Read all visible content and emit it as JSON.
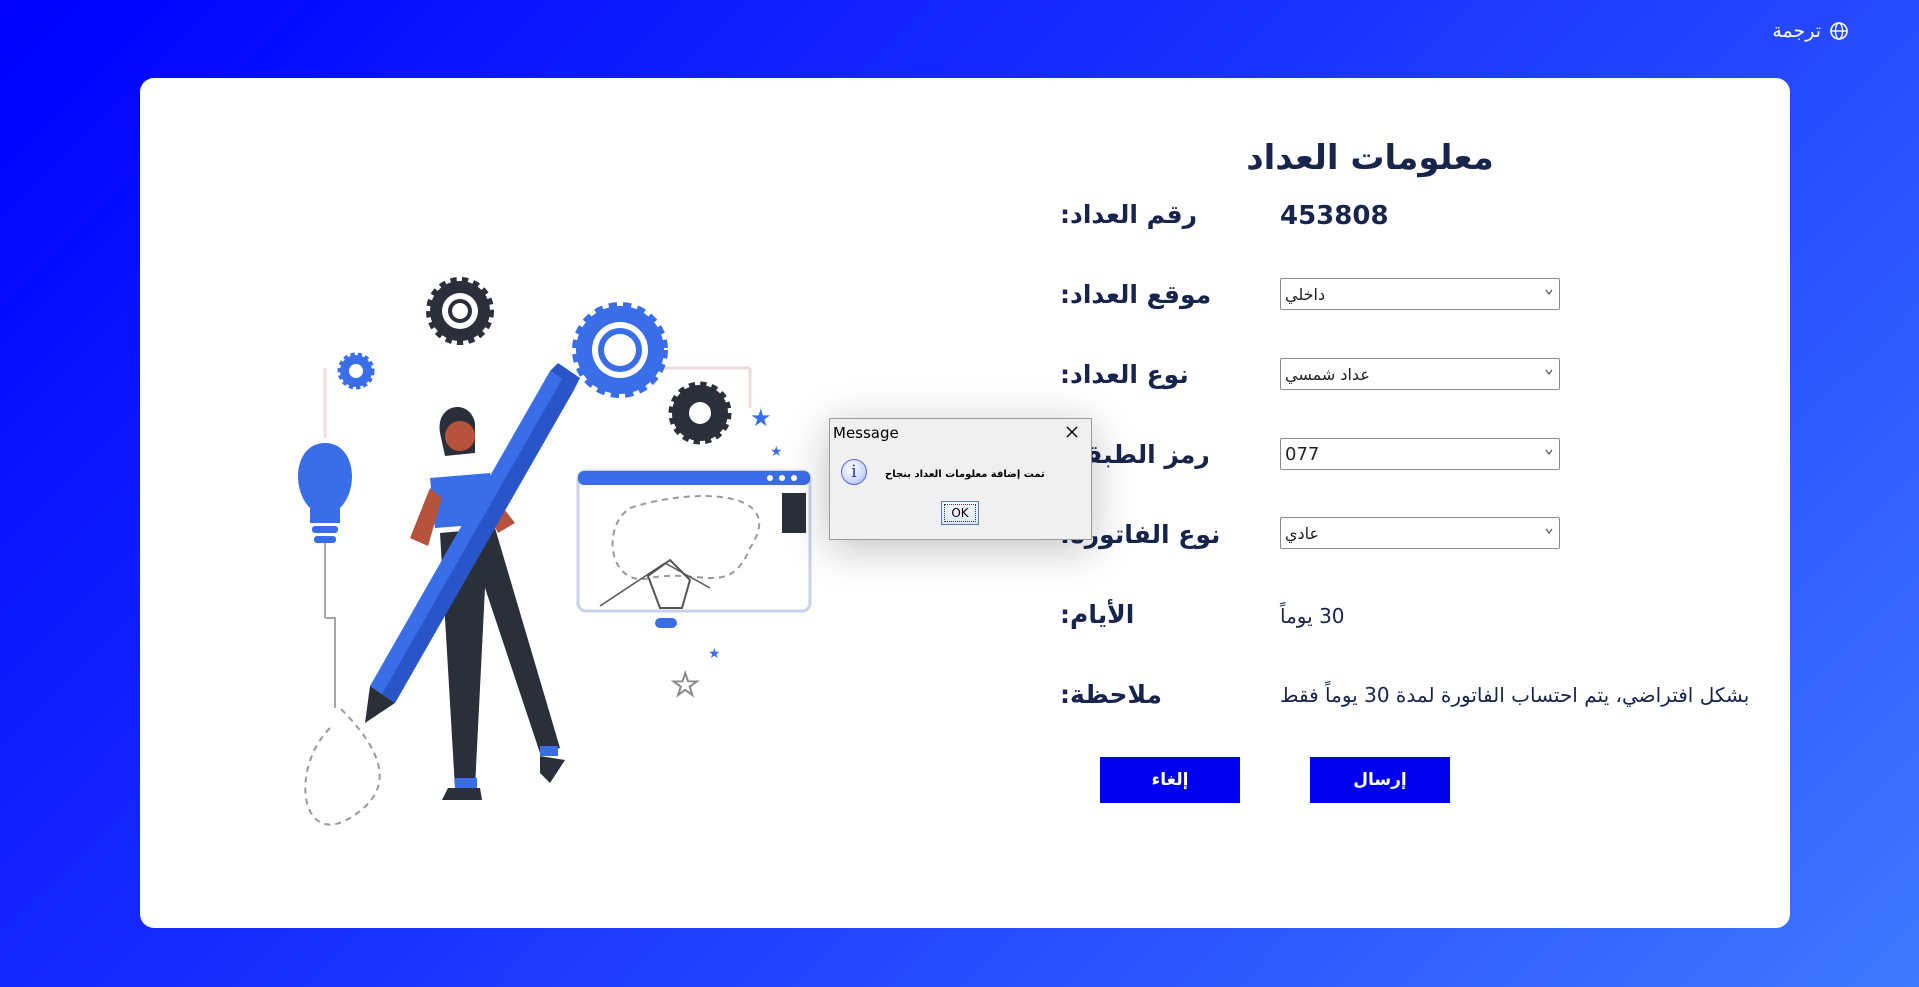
{
  "header": {
    "translate_label": "ترجمة",
    "translate_icon": "globe-icon"
  },
  "form": {
    "title": "معلومات العداد",
    "meter_number_label": "رقم العداد:",
    "meter_number_value": "453808",
    "location_label": "موقع العداد:",
    "location_value": "داخلي",
    "type_label": "نوع العداد:",
    "type_value": "عداد شمسي",
    "code_label": "رمز الطبقة:",
    "code_value": "077",
    "invoice_type_label": "نوع الفاتورة:",
    "invoice_type_value": "عادي",
    "days_label": "الأيام:",
    "days_value": "30 يوماً",
    "note_label": "ملاحظة:",
    "note_value": "بشكل افتراضي، يتم احتساب الفاتورة لمدة 30 يوماً فقط",
    "submit_label": "إرسال",
    "cancel_label": "إلغاء"
  },
  "dialog": {
    "title": "Message",
    "message": "تمت إضافة معلومات العداد بنجاح",
    "ok_label": "OK",
    "icon": "info-icon"
  },
  "colors": {
    "accent": "#0000f0",
    "text": "#17254d",
    "illustration_blue": "#3a6ee8"
  }
}
